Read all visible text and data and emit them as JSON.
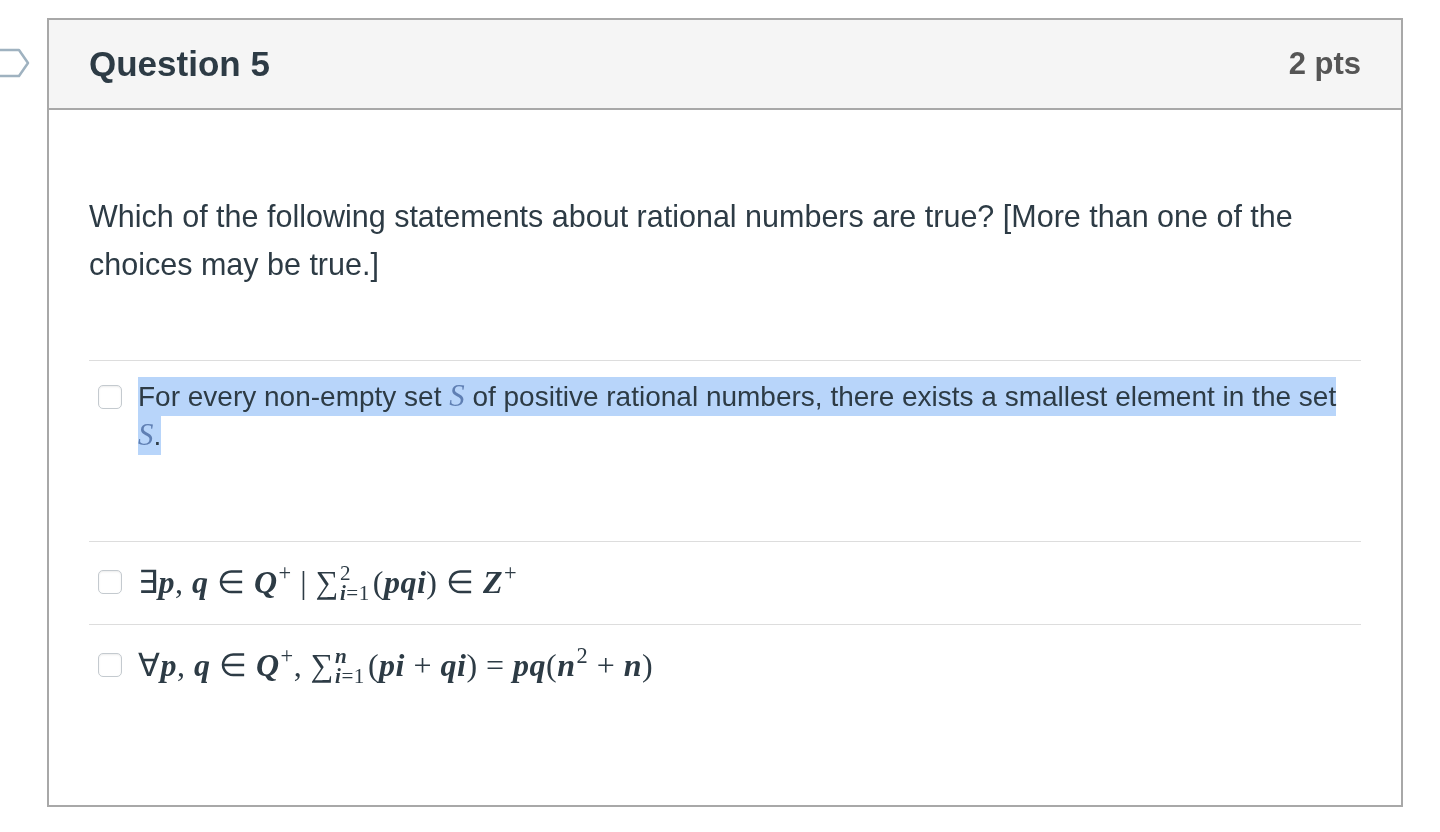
{
  "question": {
    "flagged": false,
    "title": "Question 5",
    "points": "2 pts",
    "prompt": "Which of the following statements about rational numbers are true? [More than one of the choices may be true.]"
  },
  "answers": [
    {
      "kind": "text",
      "checked": false,
      "highlighted": true,
      "text": "For every non-empty set *S* of positive rational numbers, there exists a smallest element in the set *S*."
    },
    {
      "kind": "math",
      "checked": false,
      "highlighted": false,
      "parts": [
        {
          "base": "∃*p*, *q* ∈ *Q*",
          "sup": "+"
        },
        {
          "base": " | ∑",
          "sup": "2",
          "sub": "*i*=1"
        },
        {
          "base": "(*pqi*) ∈ *Z*",
          "sup": "+"
        }
      ]
    },
    {
      "kind": "math",
      "checked": false,
      "highlighted": false,
      "parts": [
        {
          "base": "∀*p*, *q* ∈ *Q*",
          "sup": "+"
        },
        {
          "base": ", ∑",
          "sup": "*n*",
          "sub": "*i*=1"
        },
        {
          "base": "(*pi* + *qi*) = *pq*(*n*",
          "sup": "2"
        },
        {
          "base": " + *n*)"
        }
      ]
    }
  ]
}
